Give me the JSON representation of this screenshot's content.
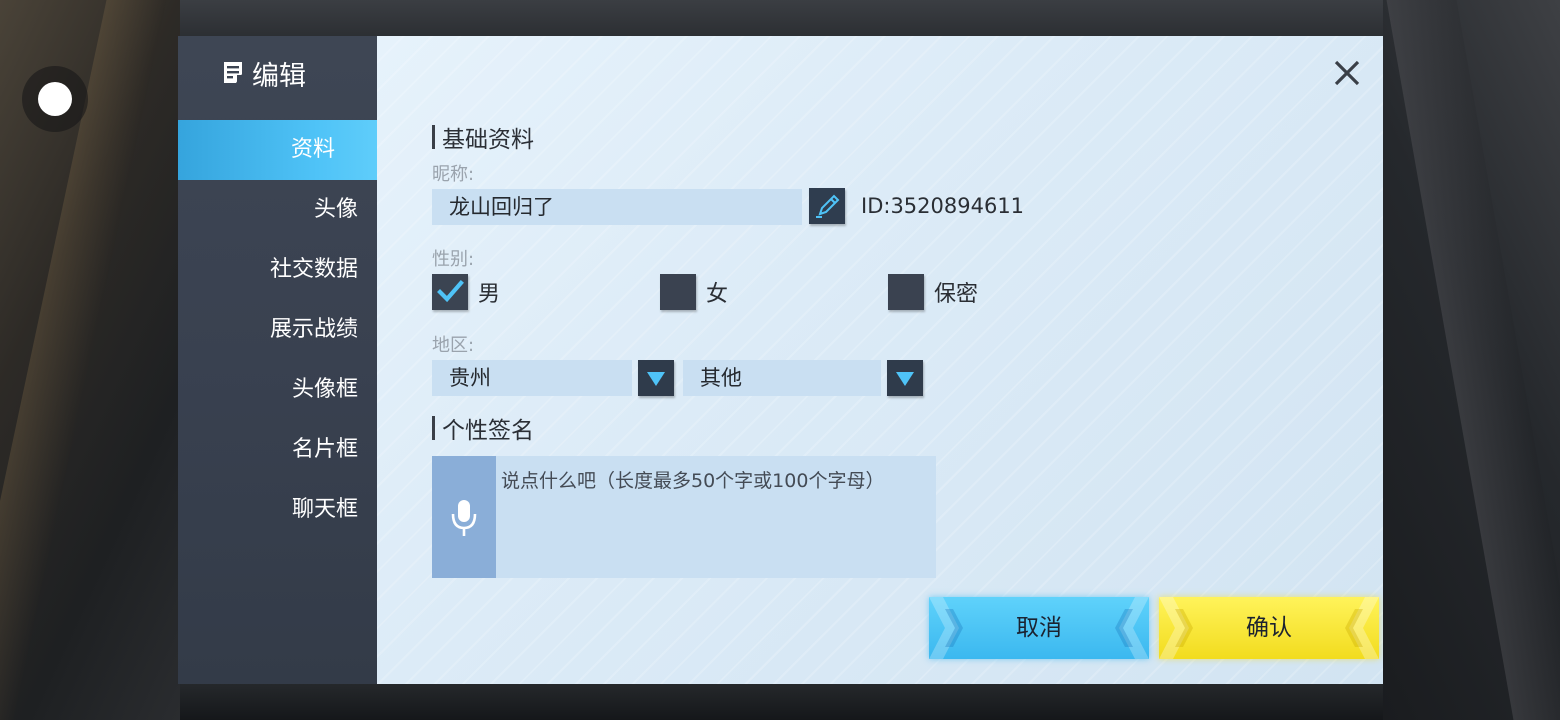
{
  "dialog": {
    "title": "编辑"
  },
  "sidebar": {
    "items": [
      {
        "label": "资料",
        "active": true
      },
      {
        "label": "头像",
        "active": false
      },
      {
        "label": "社交数据",
        "active": false
      },
      {
        "label": "展示战绩",
        "active": false
      },
      {
        "label": "头像框",
        "active": false
      },
      {
        "label": "名片框",
        "active": false
      },
      {
        "label": "聊天框",
        "active": false
      }
    ]
  },
  "basic": {
    "section_title": "基础资料",
    "nickname_label": "昵称:",
    "nickname_value": "龙山回归了",
    "id_text": "ID:3520894611",
    "gender_label": "性别:",
    "gender_options": [
      {
        "label": "男",
        "checked": true
      },
      {
        "label": "女",
        "checked": false
      },
      {
        "label": "保密",
        "checked": false
      }
    ],
    "region_label": "地区:",
    "region_province": "贵州",
    "region_city": "其他"
  },
  "signature": {
    "section_title": "个性签名",
    "placeholder": "说点什么吧（长度最多50个字或100个字母）"
  },
  "actions": {
    "cancel_label": "取消",
    "confirm_label": "确认"
  },
  "colors": {
    "accent_blue": "#4fc3f7",
    "accent_yellow": "#f7e534",
    "checkmark": "#4fc3f7"
  }
}
